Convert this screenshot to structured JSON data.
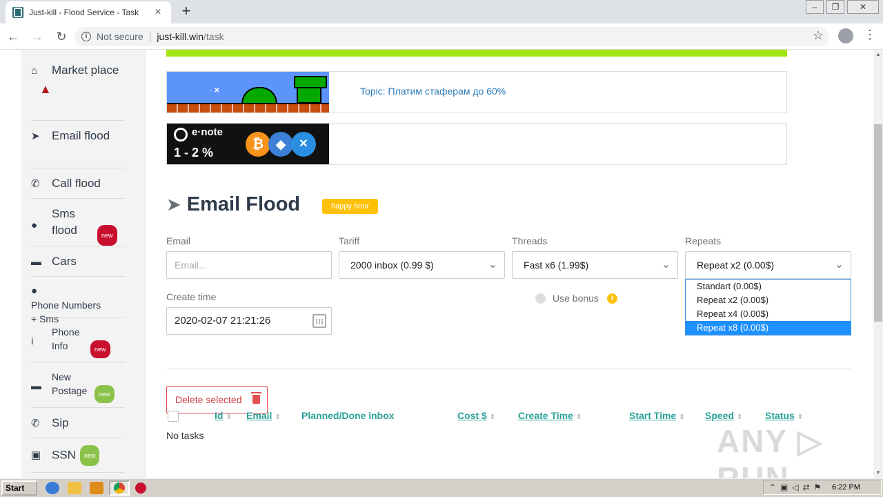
{
  "browser": {
    "tab_title": "Just-kill - Flood Service - Task",
    "new_tab": "+",
    "security": "Not secure",
    "url_host": "just-kill.win",
    "url_path": "/task"
  },
  "sidebar": {
    "items": [
      {
        "label": "Market place",
        "icon": "basket-icon"
      },
      {
        "label": "Email flood",
        "icon": "paper-plane-icon"
      },
      {
        "label": "Call flood",
        "icon": "phone-icon"
      },
      {
        "label": "Sms flood",
        "icon": "chat-icon",
        "badge": "new"
      },
      {
        "label": "Cars",
        "icon": "car-icon"
      },
      {
        "label": "Phone Numbers + Sms",
        "icon": "chat-icon"
      },
      {
        "label": "Phone Info",
        "icon": "info-icon",
        "badge": "new"
      },
      {
        "label": "New Postage",
        "icon": "envelope-icon",
        "badge": "new"
      },
      {
        "label": "Sip",
        "icon": "phone-volume-icon"
      },
      {
        "label": "SSN",
        "icon": "id-card-icon",
        "badge": "new"
      }
    ]
  },
  "banners": {
    "topic_text": "Topic: Платим стаферам до 60%",
    "mario_text": "· ✕",
    "enote_brand": "e·note",
    "enote_percent": "1 - 2 %"
  },
  "form": {
    "title": "Email Flood",
    "happy_hour": "happy hour",
    "email_label": "Email",
    "email_placeholder": "Email...",
    "tariff_label": "Tariff",
    "tariff_value": "2000 inbox (0.99 $)",
    "threads_label": "Threads",
    "threads_value": "Fast x6 (1.99$)",
    "repeats_label": "Repeats",
    "repeats_value": "Repeat x2 (0.00$)",
    "repeats_options": [
      "Standart (0.00$)",
      "Repeat x2 (0.00$)",
      "Repeat x4 (0.00$)",
      "Repeat x8 (0.00$)"
    ],
    "repeats_highlighted": "Repeat x8 (0.00$)",
    "create_time_label": "Create time",
    "create_time_value": "2020-02-07 21:21:26",
    "use_bonus_label": "Use bonus"
  },
  "table": {
    "delete_label": "Delete selected",
    "columns": [
      "Id",
      "Email",
      "Planned/Done inbox",
      "Cost $",
      "Create Time",
      "Start Time",
      "Speed",
      "Status"
    ],
    "empty_text": "No tasks"
  },
  "watermark": "ANY ▷ RUN",
  "taskbar": {
    "start": "Start",
    "clock": "6:22 PM"
  }
}
